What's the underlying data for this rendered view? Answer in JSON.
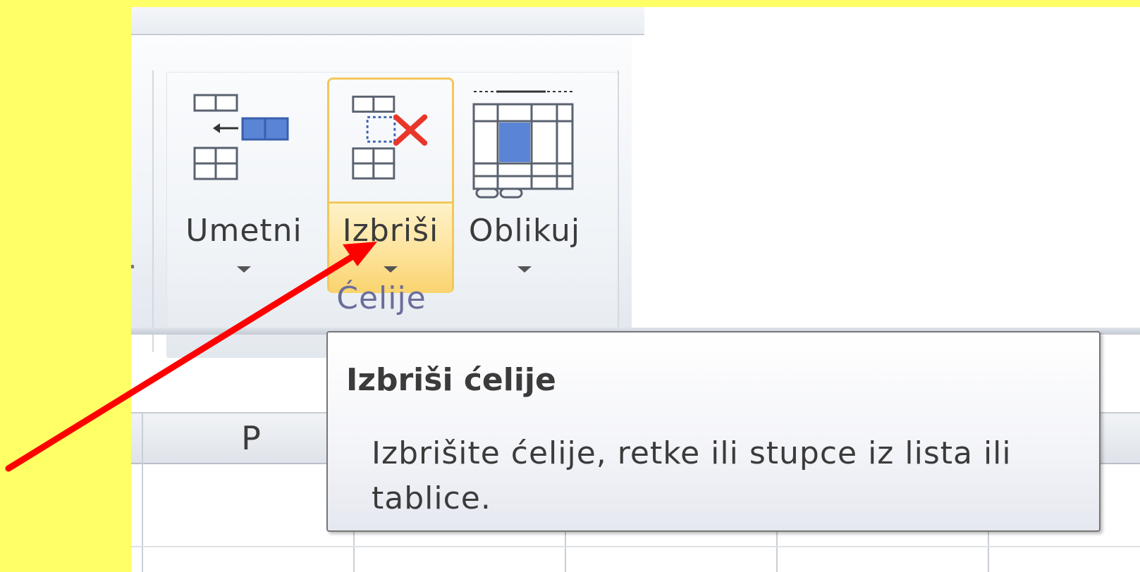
{
  "ribbon": {
    "buttons": [
      {
        "label": "Umetni",
        "icon": "insert-cells-icon"
      },
      {
        "label": "Izbriši",
        "icon": "delete-cells-icon"
      },
      {
        "label": "Oblikuj",
        "icon": "format-cells-icon"
      }
    ],
    "group_label": "Ćelije"
  },
  "sheet": {
    "column_header": "P"
  },
  "tooltip": {
    "title": "Izbriši ćelije",
    "description": "Izbrišite ćelije, retke ili stupce iz lista ili tablice."
  },
  "colors": {
    "highlight_background": "#ffff66",
    "annotation_arrow": "#ff0000",
    "hover_border": "#f2c85a",
    "hover_fill": "#fde39b"
  },
  "icons": [
    "insert-cells-icon",
    "delete-cells-icon",
    "format-cells-icon",
    "dropdown-arrow-icon",
    "annotation-arrow-icon"
  ]
}
